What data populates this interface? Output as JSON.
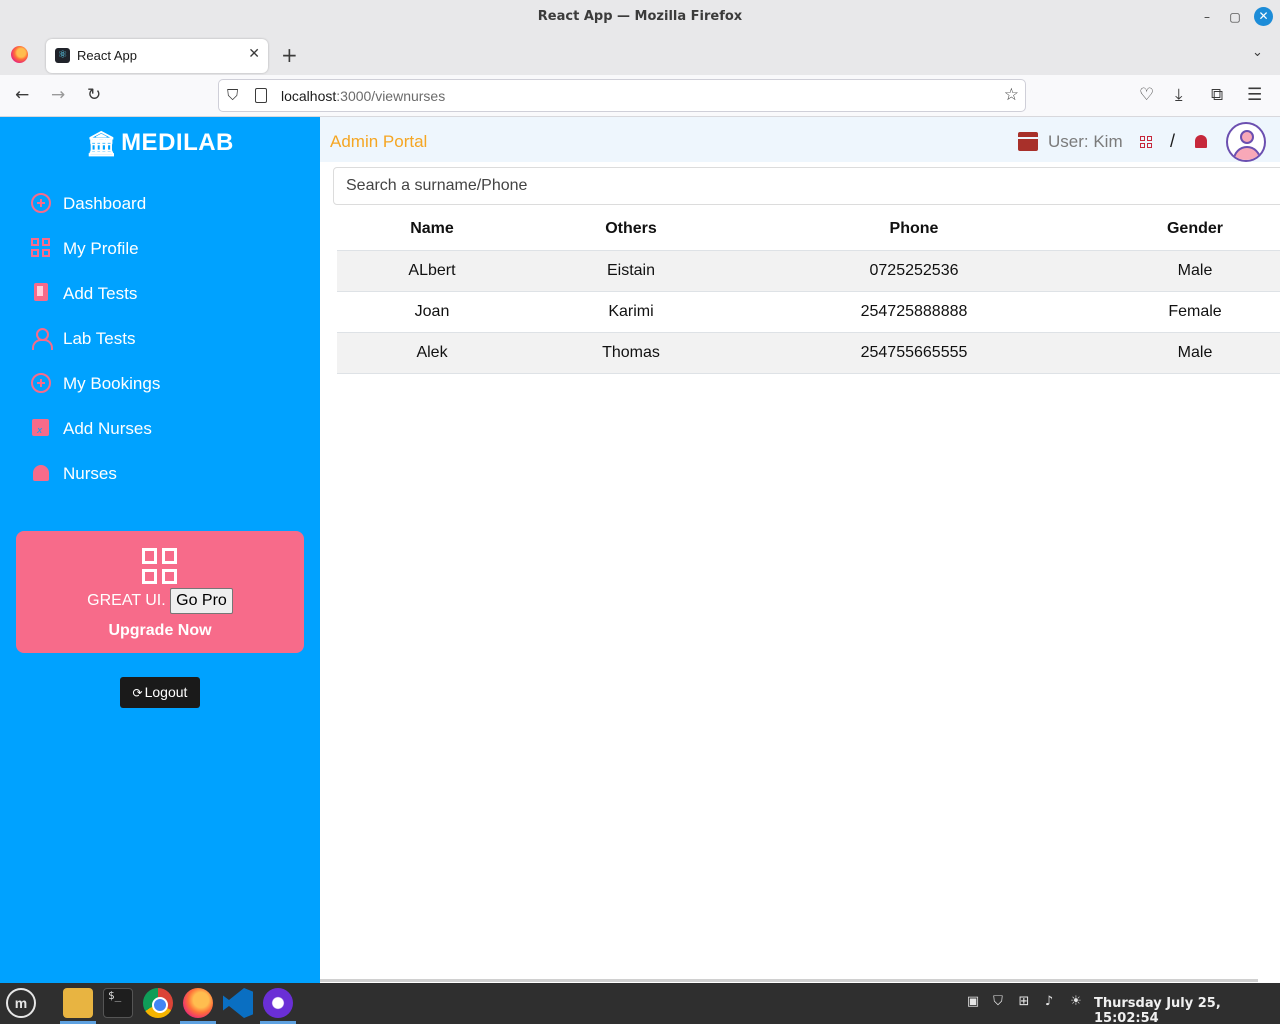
{
  "window": {
    "title": "React App — Mozilla Firefox"
  },
  "browser": {
    "tab_title": "React App",
    "url_host": "localhost",
    "url_path": ":3000/viewnurses"
  },
  "sidebar": {
    "brand": "MEDILAB",
    "items": [
      {
        "label": "Dashboard",
        "icon": "plus-circle-icon"
      },
      {
        "label": "My Profile",
        "icon": "grid-icon"
      },
      {
        "label": "Add Tests",
        "icon": "book-icon"
      },
      {
        "label": "Lab Tests",
        "icon": "person-icon"
      },
      {
        "label": "My Bookings",
        "icon": "plus-circle-icon"
      },
      {
        "label": "Add Nurses",
        "icon": "calendar-icon"
      },
      {
        "label": "Nurses",
        "icon": "bell-icon"
      }
    ],
    "promo": {
      "text": "GREAT UI.",
      "button": "Go Pro",
      "cta": "Upgrade Now"
    },
    "logout": "Logout"
  },
  "topbar": {
    "portal_title": "Admin Portal",
    "user_label": "User: Kim",
    "separator": "/"
  },
  "search": {
    "placeholder": "Search a surname/Phone",
    "value": ""
  },
  "table": {
    "columns": [
      "Name",
      "Others",
      "Phone",
      "Gender"
    ],
    "rows": [
      {
        "name": "ALbert",
        "others": "Eistain",
        "phone": "0725252536",
        "gender": "Male"
      },
      {
        "name": "Joan",
        "others": "Karimi",
        "phone": "254725888888",
        "gender": "Female"
      },
      {
        "name": "Alek",
        "others": "Thomas",
        "phone": "254755665555",
        "gender": "Male"
      }
    ]
  },
  "taskbar": {
    "clock": "Thursday July 25, 15:02:54"
  },
  "colors": {
    "sidebar_bg": "#00a2ff",
    "accent_pink": "#f76b8a",
    "portal_title": "#f5a623",
    "topbar_bg": "#eef6fd"
  }
}
